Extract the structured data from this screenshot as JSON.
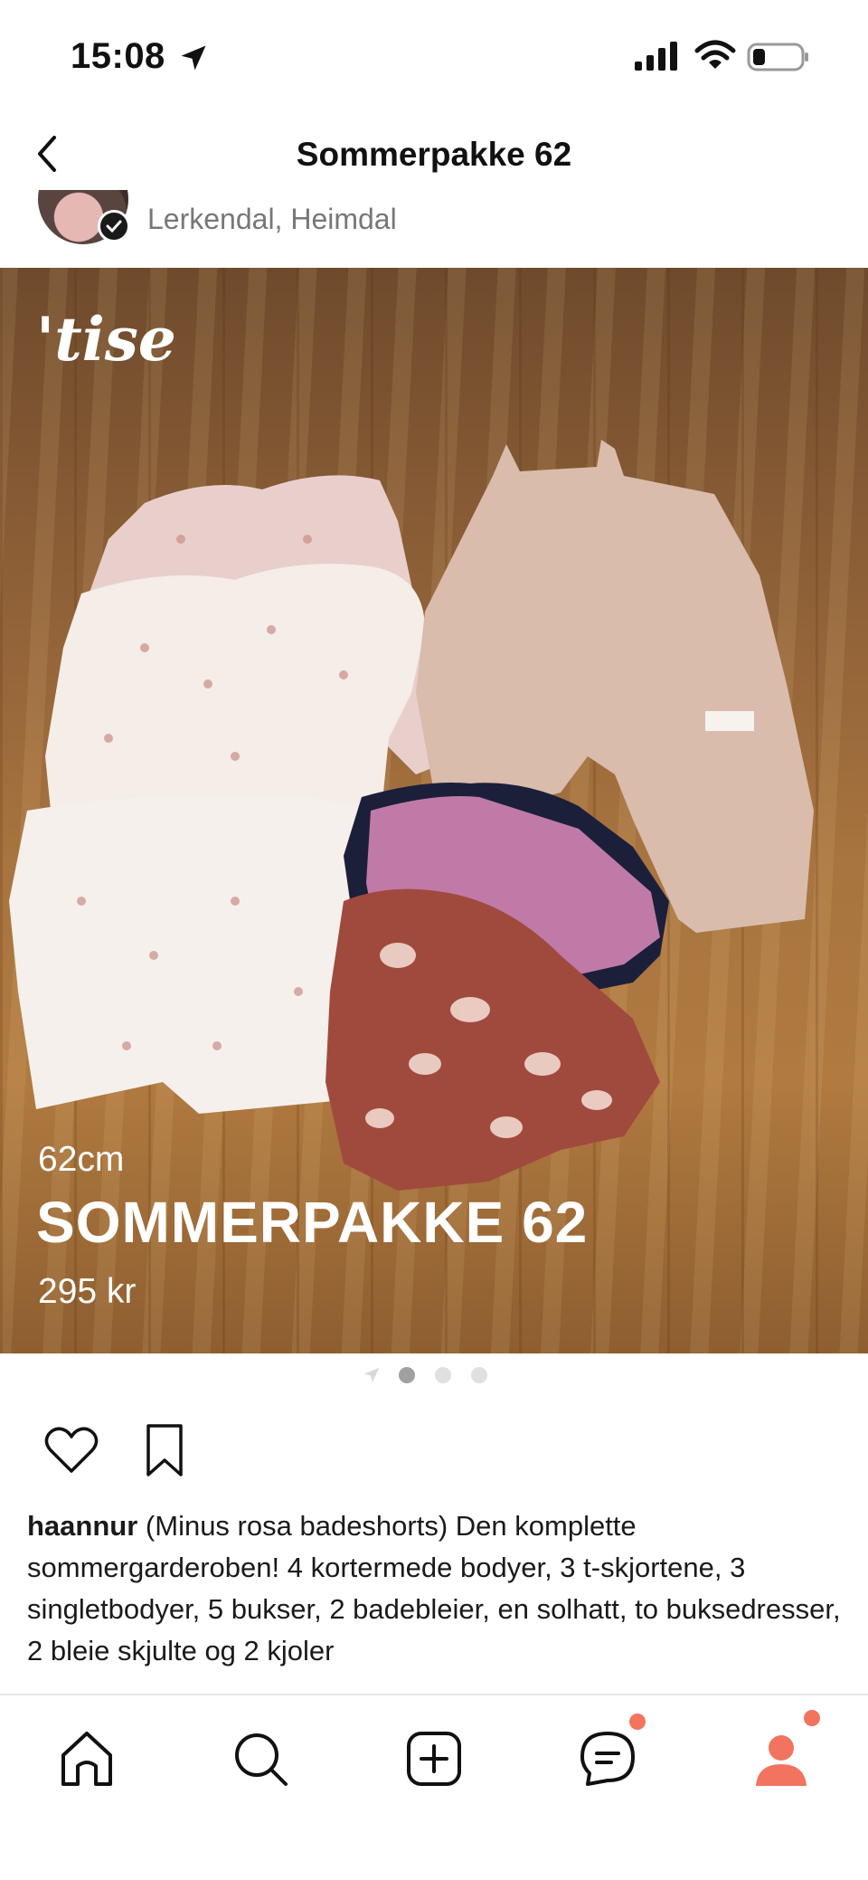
{
  "status_bar": {
    "time": "15:08"
  },
  "header": {
    "title": "Sommerpakke 62"
  },
  "seller": {
    "location": "Lerkendal, Heimdal"
  },
  "image_overlay": {
    "watermark": "'tise",
    "size": "62cm",
    "title": "SOMMERPAKKE 62",
    "price": "295 kr"
  },
  "pagination": {
    "total": 3,
    "active": 1
  },
  "post": {
    "username": "haannur",
    "description": "(Minus rosa badeshorts) Den komplette sommergarderoben! 4 kortermede bodyer, 3 t-skjortene, 3 singletbodyer, 5 bukser, 2 badebleier, en solhatt, to buksedresser, 2 bleie skjulte og 2 kjoler"
  },
  "tab_bar": {
    "items": [
      {
        "icon": "home-icon"
      },
      {
        "icon": "search-icon"
      },
      {
        "icon": "add-listing-icon"
      },
      {
        "icon": "messages-icon",
        "badge": true
      },
      {
        "icon": "profile-icon",
        "badge": true,
        "active": true
      }
    ]
  },
  "colors": {
    "accent": "#f2735e",
    "text": "#111111",
    "muted": "#777777"
  }
}
